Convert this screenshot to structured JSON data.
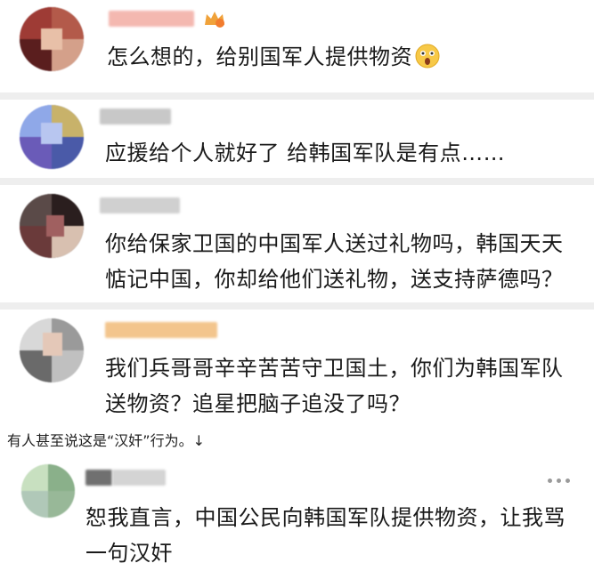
{
  "comments": [
    {
      "text": "怎么想的，给别国军人提供物资"
    },
    {
      "text": "应援给个人就好了 给韩国军队是有点……"
    },
    {
      "line1": "你给保家卫国的中国军人送过礼物吗，韩国天天",
      "line2": "惦记中国，你却给他们送礼物，送支持萨德吗？"
    },
    {
      "line1": "我们兵哥哥辛辛苦苦守卫国土，你们为韩国军队",
      "line2": "送物资？追星把脑子追没了吗？"
    },
    {
      "line1": "恕我直言，中国公民向韩国军队提供物资，让我骂",
      "line2": "一句汉奸"
    }
  ],
  "caption": "有人甚至说这是“汉奸”行为。↓",
  "colors": {
    "divider": "#eeeeee",
    "username_pink": "#f4b8b0",
    "username_orange": "#f3c58d",
    "username_gray": "#c8c8c8",
    "crown": "#f0a23a"
  },
  "icons": [
    "crown-badge-icon",
    "shocked-face-emoji-icon",
    "more-options-icon"
  ]
}
